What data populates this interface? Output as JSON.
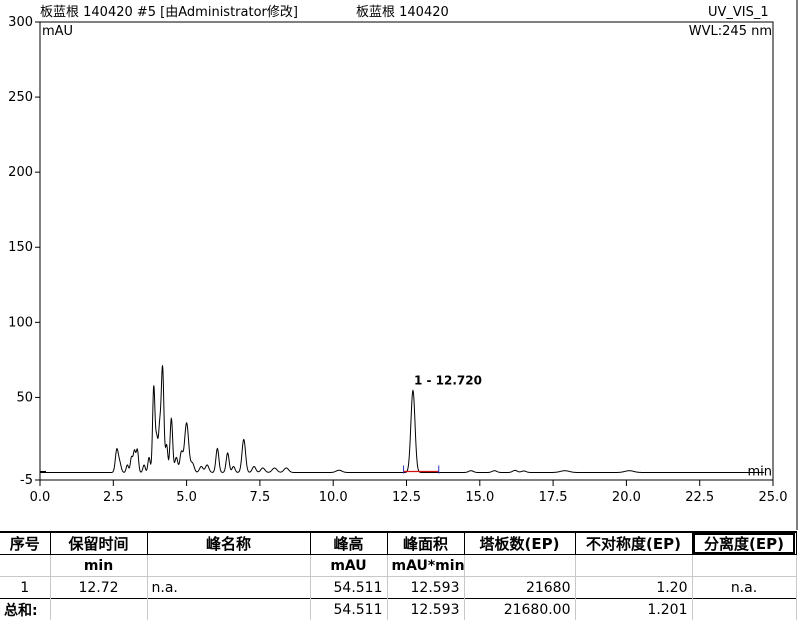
{
  "header": {
    "left_title": "板蓝根 140420 #5 [由Administrator修改]",
    "center_title": "板蓝根 140420",
    "channel": "UV_VIS_1",
    "wavelength": "WVL:245 nm"
  },
  "chart_data": {
    "type": "line",
    "ylabel": "mAU",
    "xlabel": "min",
    "xlim": [
      0,
      25
    ],
    "ylim": [
      -5,
      300
    ],
    "xticks": [
      "0.0",
      "2.5",
      "5.0",
      "7.5",
      "10.0",
      "12.5",
      "15.0",
      "17.5",
      "20.0",
      "22.5",
      "25.0"
    ],
    "yticks": [
      "-5",
      "50",
      "100",
      "150",
      "200",
      "250",
      "300"
    ],
    "baseline": 0,
    "peaks": [
      {
        "t": 2.62,
        "h": 15,
        "w": 0.05
      },
      {
        "t": 2.72,
        "h": 6,
        "w": 0.05
      },
      {
        "t": 2.98,
        "h": 5,
        "w": 0.04
      },
      {
        "t": 3.12,
        "h": 10,
        "w": 0.04
      },
      {
        "t": 3.22,
        "h": 14,
        "w": 0.04
      },
      {
        "t": 3.32,
        "h": 15,
        "w": 0.04
      },
      {
        "t": 3.55,
        "h": 5,
        "w": 0.04
      },
      {
        "t": 3.72,
        "h": 10,
        "w": 0.04
      },
      {
        "t": 3.88,
        "h": 57,
        "w": 0.04
      },
      {
        "t": 3.98,
        "h": 22,
        "w": 0.04
      },
      {
        "t": 4.08,
        "h": 28,
        "w": 0.04
      },
      {
        "t": 4.18,
        "h": 70,
        "w": 0.045
      },
      {
        "t": 4.32,
        "h": 18,
        "w": 0.04
      },
      {
        "t": 4.48,
        "h": 36,
        "w": 0.045
      },
      {
        "t": 4.65,
        "h": 10,
        "w": 0.05
      },
      {
        "t": 4.82,
        "h": 13,
        "w": 0.05
      },
      {
        "t": 5.0,
        "h": 33,
        "w": 0.07
      },
      {
        "t": 5.2,
        "h": 6,
        "w": 0.06
      },
      {
        "t": 5.5,
        "h": 4,
        "w": 0.06
      },
      {
        "t": 5.7,
        "h": 5,
        "w": 0.06
      },
      {
        "t": 6.05,
        "h": 16,
        "w": 0.05
      },
      {
        "t": 6.4,
        "h": 13,
        "w": 0.05
      },
      {
        "t": 6.6,
        "h": 4,
        "w": 0.05
      },
      {
        "t": 6.95,
        "h": 22,
        "w": 0.06
      },
      {
        "t": 7.3,
        "h": 4,
        "w": 0.06
      },
      {
        "t": 7.6,
        "h": 3,
        "w": 0.07
      },
      {
        "t": 8.0,
        "h": 3,
        "w": 0.08
      },
      {
        "t": 8.4,
        "h": 3,
        "w": 0.08
      },
      {
        "t": 10.2,
        "h": 1.5,
        "w": 0.1
      },
      {
        "t": 12.72,
        "h": 54.511,
        "w": 0.07
      },
      {
        "t": 14.7,
        "h": 1.2,
        "w": 0.08
      },
      {
        "t": 15.5,
        "h": 1.2,
        "w": 0.08
      },
      {
        "t": 16.2,
        "h": 1.4,
        "w": 0.08
      },
      {
        "t": 16.5,
        "h": 1.0,
        "w": 0.08
      },
      {
        "t": 17.9,
        "h": 1.2,
        "w": 0.15
      },
      {
        "t": 20.1,
        "h": 1.2,
        "w": 0.15
      }
    ],
    "annotations": [
      {
        "t": 12.72,
        "y": 54.511,
        "label": "1 - 12.720"
      }
    ],
    "integration_marks": [
      12.4,
      13.6
    ]
  },
  "table": {
    "headers": [
      "序号",
      "保留时间",
      "峰名称",
      "峰高",
      "峰面积",
      "塔板数(EP)",
      "不对称度(EP)",
      "分离度(EP)"
    ],
    "units": [
      "",
      "min",
      "",
      "mAU",
      "mAU*min",
      "",
      "",
      ""
    ],
    "rows": [
      [
        "1",
        "12.72",
        "n.a.",
        "54.511",
        "12.593",
        "21680",
        "1.20",
        "n.a."
      ]
    ],
    "total": [
      "总和:",
      "",
      "",
      "54.511",
      "12.593",
      "21680.00",
      "1.201",
      ""
    ]
  },
  "colors": {
    "trace": "#000000",
    "plot_border": "#000000",
    "integration_marker": "#d01010",
    "baseline_marker": "#3030c0"
  }
}
